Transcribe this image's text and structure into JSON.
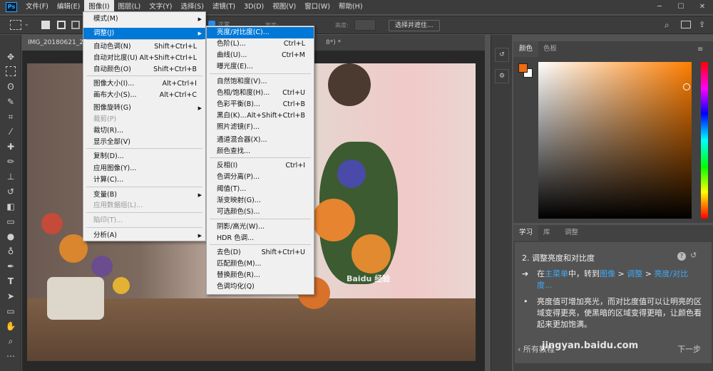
{
  "menubar": {
    "logo": "Ps",
    "items": [
      "文件(F)",
      "编辑(E)",
      "图像(I)",
      "图层(L)",
      "文字(Y)",
      "选择(S)",
      "滤镜(T)",
      "3D(D)",
      "视图(V)",
      "窗口(W)",
      "帮助(H)"
    ]
  },
  "window": {
    "min": "─",
    "max": "☐",
    "close": "✕"
  },
  "options": {
    "mode": "正常",
    "width_label": "宽度:",
    "height_label": "高度:",
    "select_mask": "选择并遮住..."
  },
  "doctabs": {
    "tab1": "IMG_20180621_22",
    "tab2": "8*) *"
  },
  "image_menu": {
    "items": [
      {
        "label": "模式(M)",
        "shortcut": "",
        "submenu": true
      },
      {
        "label": "调整(J)",
        "shortcut": "",
        "submenu": true
      },
      {
        "label": "自动色调(N)",
        "shortcut": "Shift+Ctrl+L"
      },
      {
        "label": "自动对比度(U)",
        "shortcut": "Alt+Shift+Ctrl+L"
      },
      {
        "label": "自动颜色(O)",
        "shortcut": "Shift+Ctrl+B"
      },
      {
        "label": "图像大小(I)...",
        "shortcut": "Alt+Ctrl+I"
      },
      {
        "label": "画布大小(S)...",
        "shortcut": "Alt+Ctrl+C"
      },
      {
        "label": "图像旋转(G)",
        "shortcut": "",
        "submenu": true
      },
      {
        "label": "裁剪(P)",
        "shortcut": "",
        "disabled": true
      },
      {
        "label": "裁切(R)...",
        "shortcut": ""
      },
      {
        "label": "显示全部(V)",
        "shortcut": ""
      },
      {
        "label": "复制(D)...",
        "shortcut": ""
      },
      {
        "label": "应用图像(Y)...",
        "shortcut": ""
      },
      {
        "label": "计算(C)...",
        "shortcut": ""
      },
      {
        "label": "变量(B)",
        "shortcut": "",
        "submenu": true
      },
      {
        "label": "应用数据组(L)...",
        "shortcut": "",
        "disabled": true
      },
      {
        "label": "陷印(T)...",
        "shortcut": "",
        "disabled": true
      },
      {
        "label": "分析(A)",
        "shortcut": "",
        "submenu": true
      }
    ]
  },
  "adjust_menu": {
    "items": [
      {
        "label": "亮度/对比度(C)...",
        "shortcut": ""
      },
      {
        "label": "色阶(L)...",
        "shortcut": "Ctrl+L"
      },
      {
        "label": "曲线(U)...",
        "shortcut": "Ctrl+M"
      },
      {
        "label": "曝光度(E)...",
        "shortcut": ""
      },
      {
        "label": "自然饱和度(V)...",
        "shortcut": ""
      },
      {
        "label": "色相/饱和度(H)...",
        "shortcut": "Ctrl+U"
      },
      {
        "label": "色彩平衡(B)...",
        "shortcut": "Ctrl+B"
      },
      {
        "label": "黑白(K)...",
        "shortcut": "Alt+Shift+Ctrl+B"
      },
      {
        "label": "照片滤镜(F)...",
        "shortcut": ""
      },
      {
        "label": "通道混合器(X)...",
        "shortcut": ""
      },
      {
        "label": "颜色查找...",
        "shortcut": ""
      },
      {
        "label": "反相(I)",
        "shortcut": "Ctrl+I"
      },
      {
        "label": "色调分离(P)...",
        "shortcut": ""
      },
      {
        "label": "阈值(T)...",
        "shortcut": ""
      },
      {
        "label": "渐变映射(G)...",
        "shortcut": ""
      },
      {
        "label": "可选颜色(S)...",
        "shortcut": ""
      },
      {
        "label": "阴影/高光(W)...",
        "shortcut": ""
      },
      {
        "label": "HDR 色调...",
        "shortcut": ""
      },
      {
        "label": "去色(D)",
        "shortcut": "Shift+Ctrl+U"
      },
      {
        "label": "匹配颜色(M)...",
        "shortcut": ""
      },
      {
        "label": "替换颜色(R)...",
        "shortcut": ""
      },
      {
        "label": "色调均化(Q)",
        "shortcut": ""
      }
    ]
  },
  "color_panel": {
    "tab_color": "颜色",
    "tab_swatch": "色板",
    "fg_color": "#f26b10",
    "bg_color": "#ffffff"
  },
  "learn_panel": {
    "tabs": [
      "学习",
      "库",
      "调整"
    ],
    "step_title": "2. 调整亮度和对比度",
    "instr_pre": "在",
    "instr_link1": "主菜单",
    "instr_mid": "中，转到",
    "instr_link2": "图像",
    "instr_sep1": " > ",
    "instr_link3": "调整",
    "instr_sep2": " > ",
    "instr_link4": "亮度/对比度...",
    "para": "亮度值可增加亮光，而对比度值可以让明亮的区域变得更亮，使黑暗的区域变得更暗，让颜色看起来更加饱满。",
    "nav_prev": "所有教程",
    "nav_next": "下一步"
  },
  "watermark": "jingyan.baidu.com",
  "watermark_brand": "Baidu 经验"
}
